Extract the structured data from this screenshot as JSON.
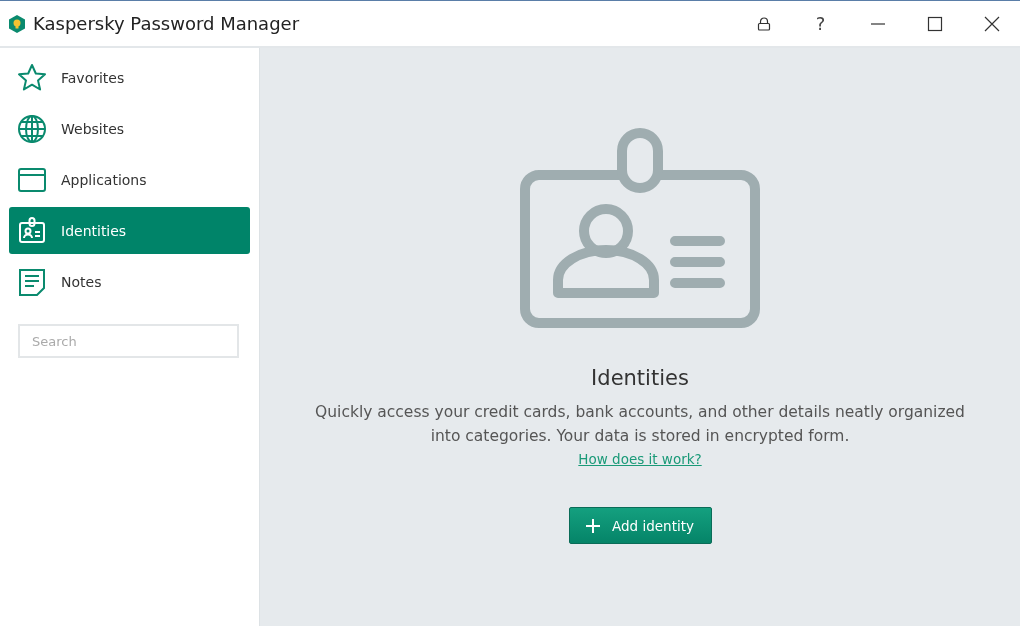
{
  "window": {
    "title": "Kaspersky Password Manager",
    "help": "?"
  },
  "sidebar": {
    "items": [
      {
        "kind": "favorites",
        "label": "Favorites",
        "selected": false
      },
      {
        "kind": "websites",
        "label": "Websites",
        "selected": false
      },
      {
        "kind": "applications",
        "label": "Applications",
        "selected": false
      },
      {
        "kind": "identities",
        "label": "Identities",
        "selected": true
      },
      {
        "kind": "notes",
        "label": "Notes",
        "selected": false
      }
    ],
    "search": {
      "placeholder": "Search"
    }
  },
  "main": {
    "heading": "Identities",
    "description": "Quickly access your credit cards, bank accounts, and other details neatly organized into categories. Your data is stored in encrypted form.",
    "link": "How does it work?",
    "button": "Add identity"
  }
}
